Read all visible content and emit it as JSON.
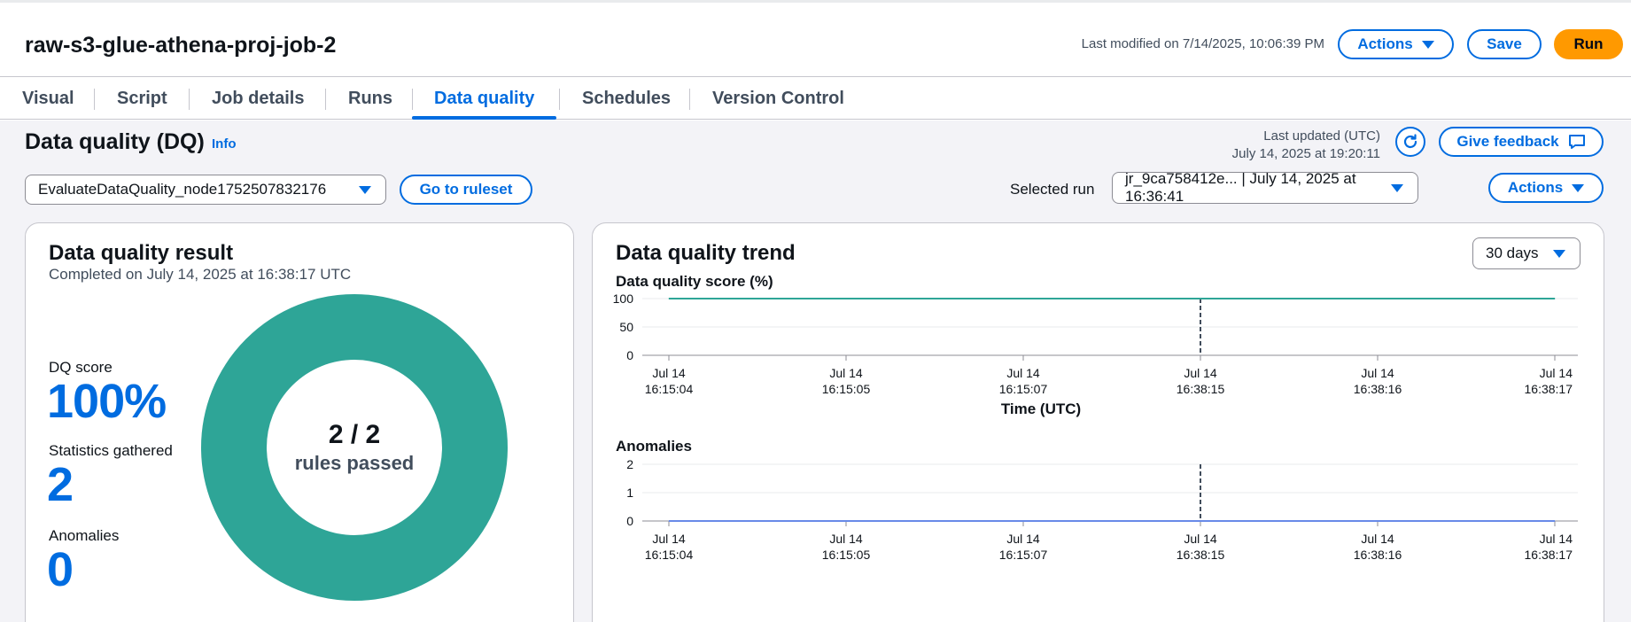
{
  "header": {
    "job_title": "raw-s3-glue-athena-proj-job-2",
    "last_modified": "Last modified on 7/14/2025, 10:06:39 PM",
    "actions_label": "Actions",
    "save_label": "Save",
    "run_label": "Run"
  },
  "tabs": [
    {
      "label": "Visual"
    },
    {
      "label": "Script"
    },
    {
      "label": "Job details"
    },
    {
      "label": "Runs"
    },
    {
      "label": "Data quality",
      "active": true
    },
    {
      "label": "Schedules"
    },
    {
      "label": "Version Control"
    }
  ],
  "dq": {
    "title": "Data quality (DQ)",
    "info": "Info",
    "last_updated_label": "Last updated (UTC)",
    "last_updated_value": "July 14, 2025 at 19:20:11",
    "feedback_label": "Give feedback",
    "node_select": "EvaluateDataQuality_node1752507832176",
    "ruleset_button": "Go to ruleset",
    "selected_run_label": "Selected run",
    "selected_run_value": "jr_9ca758412e... | July 14, 2025 at 16:36:41",
    "actions_label": "Actions"
  },
  "result": {
    "title": "Data quality result",
    "subtitle": "Completed on July 14, 2025 at 16:38:17 UTC",
    "score_label": "DQ score",
    "score_value": "100%",
    "stats_label": "Statistics gathered",
    "stats_value": "2",
    "anomalies_label": "Anomalies",
    "anomalies_value": "0",
    "rules_count": "2 / 2",
    "rules_text": "rules passed",
    "passed_fraction": 1.0
  },
  "trend": {
    "title": "Data quality trend",
    "range": "30 days",
    "score_chart_title": "Data quality score (%)",
    "anomalies_chart_title": "Anomalies"
  },
  "colors": {
    "accent": "#006ce0",
    "run": "#ff9900",
    "donut": "#2ea597",
    "anomaly_line": "#688ae8",
    "selected_run_marker": "#414d5c"
  },
  "chart_data": [
    {
      "type": "line",
      "title": "Data quality score (%)",
      "xlabel": "Time (UTC)",
      "ylabel": "",
      "x": [
        "Jul 14 16:15:04",
        "Jul 14 16:15:05",
        "Jul 14 16:15:07",
        "Jul 14 16:38:15",
        "Jul 14 16:38:16",
        "Jul 14 16:38:17"
      ],
      "x_ticks": [
        {
          "date": "Jul 14",
          "time": "16:15:04"
        },
        {
          "date": "Jul 14",
          "time": "16:15:05"
        },
        {
          "date": "Jul 14",
          "time": "16:15:07"
        },
        {
          "date": "Jul 14",
          "time": "16:38:15"
        },
        {
          "date": "Jul 14",
          "time": "16:38:16"
        },
        {
          "date": "Jul 14",
          "time": "16:38:17"
        }
      ],
      "series": [
        {
          "values": [
            100,
            100,
            100,
            100,
            100,
            100
          ]
        }
      ],
      "y_ticks": [
        0,
        50,
        100
      ],
      "ylim": [
        0,
        100
      ],
      "marker_x": "Jul 14 16:38:15",
      "grid": true
    },
    {
      "type": "line",
      "title": "Anomalies",
      "xlabel": "",
      "ylabel": "",
      "x": [
        "Jul 14 16:15:04",
        "Jul 14 16:15:05",
        "Jul 14 16:15:07",
        "Jul 14 16:38:15",
        "Jul 14 16:38:16",
        "Jul 14 16:38:17"
      ],
      "x_ticks": [
        {
          "date": "Jul 14",
          "time": "16:15:04"
        },
        {
          "date": "Jul 14",
          "time": "16:15:05"
        },
        {
          "date": "Jul 14",
          "time": "16:15:07"
        },
        {
          "date": "Jul 14",
          "time": "16:38:15"
        },
        {
          "date": "Jul 14",
          "time": "16:38:16"
        },
        {
          "date": "Jul 14",
          "time": "16:38:17"
        }
      ],
      "series": [
        {
          "values": [
            0,
            0,
            0,
            0,
            0,
            0
          ]
        }
      ],
      "y_ticks": [
        0,
        1,
        2
      ],
      "ylim": [
        0,
        2
      ],
      "marker_x": "Jul 14 16:38:15",
      "grid": true
    }
  ]
}
